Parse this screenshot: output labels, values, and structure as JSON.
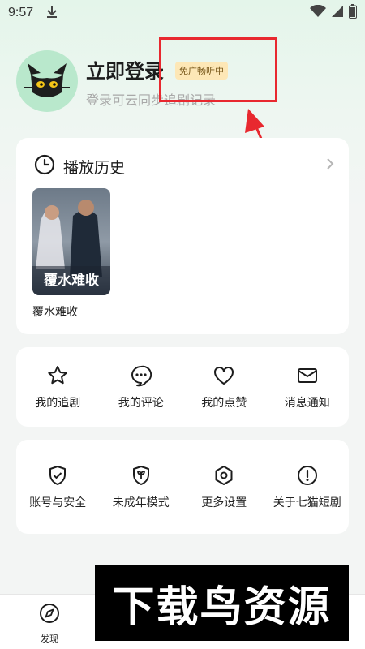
{
  "status_bar": {
    "time": "9:57"
  },
  "profile": {
    "login_title": "立即登录",
    "vip_badge": "免广畅听中",
    "subtitle": "登录可云同步追剧记录"
  },
  "history": {
    "title": "播放历史",
    "items": [
      {
        "poster_text": "覆水难收",
        "title": "覆水难收"
      }
    ]
  },
  "grid_1": [
    {
      "label": "我的追剧",
      "icon": "star-icon"
    },
    {
      "label": "我的评论",
      "icon": "comment-icon"
    },
    {
      "label": "我的点赞",
      "icon": "heart-icon"
    },
    {
      "label": "消息通知",
      "icon": "mail-icon"
    }
  ],
  "grid_2": [
    {
      "label": "账号与安全",
      "icon": "shield-check-icon"
    },
    {
      "label": "未成年模式",
      "icon": "sprout-shield-icon"
    },
    {
      "label": "更多设置",
      "icon": "hexagon-settings-icon"
    },
    {
      "label": "关于七猫短剧",
      "icon": "info-circle-icon"
    }
  ],
  "bottom_nav": {
    "discover_label": "发现"
  },
  "watermark": {
    "text": "下载鸟资源"
  },
  "colors": {
    "annotation_red": "#e8282f",
    "avatar_bg": "#b9e8cc",
    "badge_bg": "#fde7b6"
  }
}
